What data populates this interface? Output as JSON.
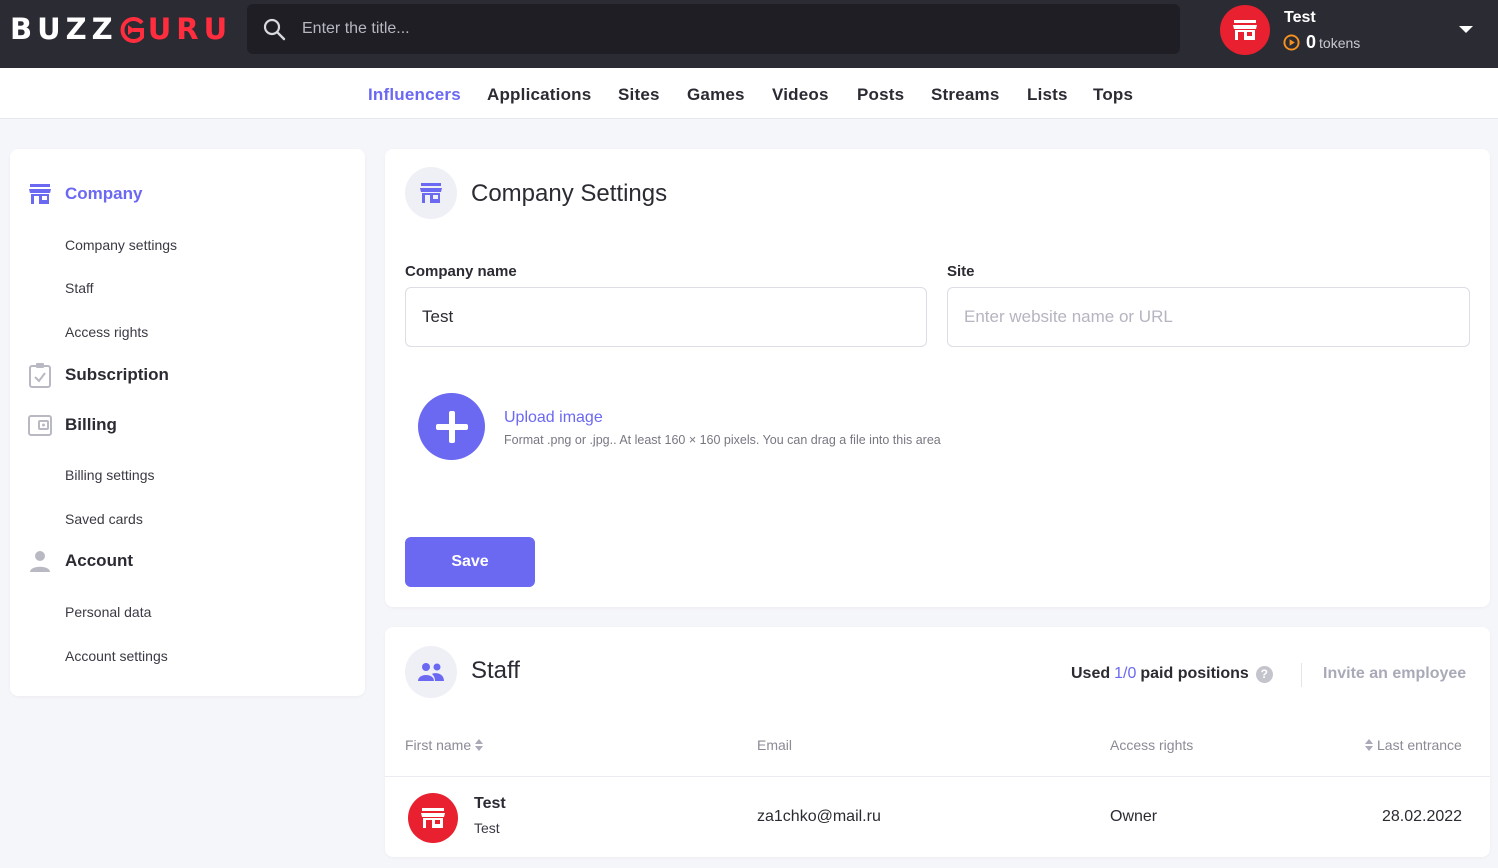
{
  "header": {
    "logo": {
      "part1": "BUZZ",
      "part2": "URU"
    },
    "search_placeholder": "Enter the title...",
    "user": {
      "name": "Test",
      "tokens_count": "0",
      "tokens_label": "tokens"
    }
  },
  "nav": {
    "items": [
      "Influencers",
      "Applications",
      "Sites",
      "Games",
      "Videos",
      "Posts",
      "Streams",
      "Lists",
      "Tops"
    ],
    "active": "Influencers"
  },
  "sidebar": {
    "sections": [
      {
        "label": "Company",
        "icon": "store-icon",
        "active": true,
        "items": [
          "Company settings",
          "Staff",
          "Access rights"
        ]
      },
      {
        "label": "Subscription",
        "icon": "clipboard-check-icon",
        "active": false,
        "items": []
      },
      {
        "label": "Billing",
        "icon": "wallet-icon",
        "active": false,
        "items": [
          "Billing settings",
          "Saved cards"
        ]
      },
      {
        "label": "Account",
        "icon": "person-icon",
        "active": false,
        "items": [
          "Personal data",
          "Account settings"
        ]
      }
    ]
  },
  "company_settings": {
    "title": "Company Settings",
    "company_name_label": "Company name",
    "company_name_value": "Test",
    "site_label": "Site",
    "site_placeholder": "Enter website name or URL",
    "upload_label": "Upload image",
    "upload_hint": "Format .png or .jpg.. At least 160 × 160 pixels. You can drag a file into this area",
    "save_label": "Save"
  },
  "staff": {
    "title": "Staff",
    "used_prefix": "Used",
    "used_value": "1/0",
    "used_suffix": "paid positions",
    "invite_label": "Invite an employee",
    "columns": [
      "First name",
      "Email",
      "Access rights",
      "Last entrance"
    ],
    "rows": [
      {
        "name": "Test",
        "company": "Test",
        "email": "za1chko@mail.ru",
        "access": "Owner",
        "last_entrance": "28.02.2022"
      }
    ]
  },
  "colors": {
    "accent": "#6b68f2",
    "brand_red": "#e8202f",
    "header_bg": "#2b2b33",
    "token_orange": "#f7931e"
  }
}
